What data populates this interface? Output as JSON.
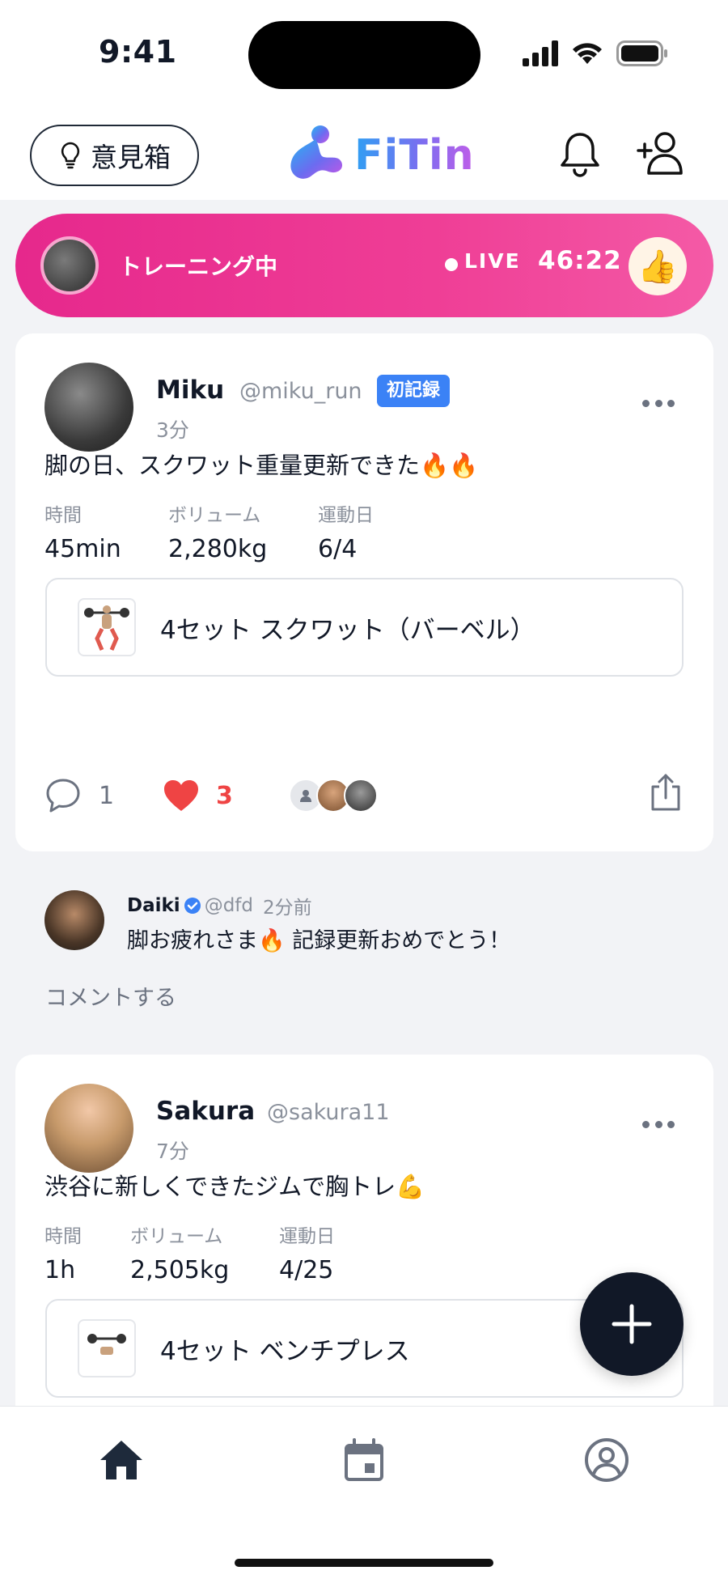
{
  "status_bar": {
    "time": "9:41"
  },
  "header": {
    "opinion_label": "意見箱",
    "logo_text": "FiTin"
  },
  "live": {
    "title": "トレーニング中",
    "label": "LIVE",
    "timer": "46:22",
    "reaction": "👍"
  },
  "posts": [
    {
      "username": "Miku",
      "handle": "@miku_run",
      "badge": "初記録",
      "time_ago": "3分",
      "text": "脚の日、スクワット重量更新できた🔥🔥",
      "stats": [
        {
          "label": "時間",
          "value": "45min"
        },
        {
          "label": "ボリューム",
          "value": "2,280kg"
        },
        {
          "label": "運動日",
          "value": "6/4"
        }
      ],
      "exercise": "4セット  スクワット（バーベル）",
      "comment_count": "1",
      "like_count": "3"
    },
    {
      "username": "Sakura",
      "handle": "@sakura11",
      "time_ago": "7分",
      "text": "渋谷に新しくできたジムで胸トレ💪",
      "stats": [
        {
          "label": "時間",
          "value": "1h"
        },
        {
          "label": "ボリューム",
          "value": "2,505kg"
        },
        {
          "label": "運動日",
          "value": "4/25"
        }
      ],
      "exercise": "4セット  ベンチプレス"
    }
  ],
  "comment": {
    "name": "Daiki",
    "handle": "@dfd",
    "time": "2分前",
    "body": "脚お疲れさま🔥 記録更新おめでとう！",
    "add_comment_label": "コメントする"
  },
  "colors": {
    "live_gradient_start": "#e6288c",
    "live_gradient_end": "#f45aa6",
    "badge": "#3b82f6",
    "like": "#ef4444",
    "fab": "#111827",
    "feed_bg": "#f2f3f6"
  },
  "tabs": [
    {
      "icon": "home-icon",
      "active": true
    },
    {
      "icon": "calendar-icon",
      "active": false
    },
    {
      "icon": "profile-icon",
      "active": false
    }
  ]
}
